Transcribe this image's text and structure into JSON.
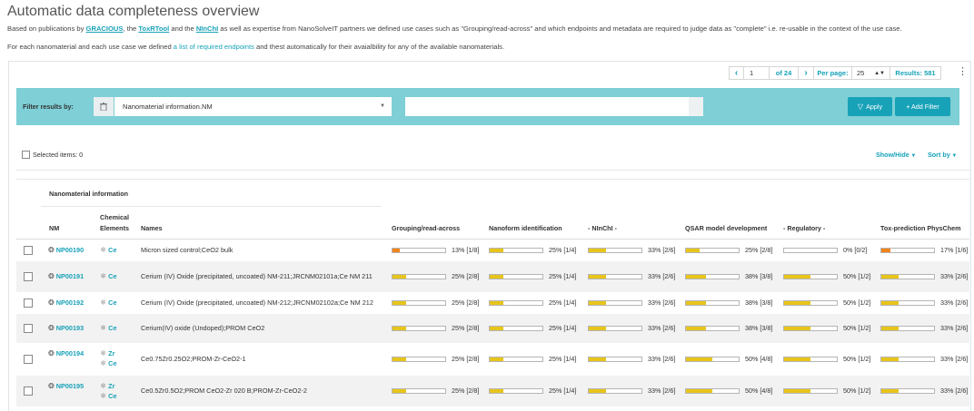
{
  "page": {
    "title": "Automatic data completeness overview",
    "intro1": {
      "pre": "Based on publications by ",
      "link1": "GRACIOUS",
      "mid1": ", the ",
      "link2": "ToxRTool",
      "mid2": " and the ",
      "link3": "NInChI",
      "post": " as well as expertise from NanoSolveIT partners we defined use cases such as \"Grouping/read-across\" and which endpoints and metadata are required to judge data as \"complete\" i.e. re-usable in the context of the use case."
    },
    "intro2": {
      "pre": "For each nanomaterial and each use case we defined ",
      "link": "a list of required endpoints",
      "post": " and thest automatically for their avaialbility for any of the available nanomaterials."
    }
  },
  "pager": {
    "prev": "‹",
    "page": "1",
    "of": "of 24",
    "next": "›",
    "per_page_label": "Per page:",
    "per_page_value": "25",
    "results": "Results: 581",
    "more": "⋮"
  },
  "filter": {
    "label": "Filter results by:",
    "selected": "Nanomaterial information.NM",
    "value": "",
    "apply": "Apply",
    "add": "+ Add Filter"
  },
  "toolbar": {
    "selected_items": "Selected items: 0",
    "show_hide": "Show/Hide",
    "sort_by": "Sort by"
  },
  "table": {
    "group_header": "Nanomaterial information",
    "headers": {
      "nm": "NM",
      "chem1": "Chemical",
      "chem2": "Elements",
      "names": "Names",
      "c1": "Grouping/read-across",
      "c2": "Nanoform identification",
      "c3": "- NInChI -",
      "c4": "QSAR model development",
      "c5": "- Regulatory -",
      "c6": "Tox-prediction PhysChem"
    },
    "colors": {
      "low": "#f0841b",
      "mid": "#e8c51a"
    },
    "rows": [
      {
        "nm": "NP00190",
        "elements": [
          "Ce"
        ],
        "name": "Micron sized control;CeO2 bulk",
        "scores": [
          {
            "pct": "13% [1/8]",
            "frac": 0.13,
            "c": "low"
          },
          {
            "pct": "25% [1/4]",
            "frac": 0.25,
            "c": "mid"
          },
          {
            "pct": "33% [2/6]",
            "frac": 0.33,
            "c": "mid"
          },
          {
            "pct": "25% [2/8]",
            "frac": 0.25,
            "c": "mid"
          },
          {
            "pct": "0% [0/2]",
            "frac": 0,
            "c": "low"
          },
          {
            "pct": "17% [1/6]",
            "frac": 0.17,
            "c": "low"
          }
        ]
      },
      {
        "nm": "NP00191",
        "elements": [
          "Ce"
        ],
        "name": "Cerium (IV) Oxide (precipitated, uncoated) NM-211;JRCNM02101a;Ce NM 211",
        "scores": [
          {
            "pct": "25% [2/8]",
            "frac": 0.25,
            "c": "mid"
          },
          {
            "pct": "25% [1/4]",
            "frac": 0.25,
            "c": "mid"
          },
          {
            "pct": "33% [2/6]",
            "frac": 0.33,
            "c": "mid"
          },
          {
            "pct": "38% [3/8]",
            "frac": 0.38,
            "c": "mid"
          },
          {
            "pct": "50% [1/2]",
            "frac": 0.5,
            "c": "mid"
          },
          {
            "pct": "33% [2/6]",
            "frac": 0.33,
            "c": "mid"
          }
        ]
      },
      {
        "nm": "NP00192",
        "elements": [
          "Ce"
        ],
        "name": "Cerium (IV) Oxide (precipitated, uncoated) NM-212;JRCNM02102a;Ce NM 212",
        "scores": [
          {
            "pct": "25% [2/8]",
            "frac": 0.25,
            "c": "mid"
          },
          {
            "pct": "25% [1/4]",
            "frac": 0.25,
            "c": "mid"
          },
          {
            "pct": "33% [2/6]",
            "frac": 0.33,
            "c": "mid"
          },
          {
            "pct": "38% [3/8]",
            "frac": 0.38,
            "c": "mid"
          },
          {
            "pct": "50% [1/2]",
            "frac": 0.5,
            "c": "mid"
          },
          {
            "pct": "33% [2/6]",
            "frac": 0.33,
            "c": "mid"
          }
        ]
      },
      {
        "nm": "NP00193",
        "elements": [
          "Ce"
        ],
        "name": "Cerium(IV) oxide (Undoped);PROM CeO2",
        "scores": [
          {
            "pct": "25% [2/8]",
            "frac": 0.25,
            "c": "mid"
          },
          {
            "pct": "25% [1/4]",
            "frac": 0.25,
            "c": "mid"
          },
          {
            "pct": "33% [2/6]",
            "frac": 0.33,
            "c": "mid"
          },
          {
            "pct": "38% [3/8]",
            "frac": 0.38,
            "c": "mid"
          },
          {
            "pct": "50% [1/2]",
            "frac": 0.5,
            "c": "mid"
          },
          {
            "pct": "33% [2/6]",
            "frac": 0.33,
            "c": "mid"
          }
        ]
      },
      {
        "nm": "NP00194",
        "elements": [
          "Zr",
          "Ce"
        ],
        "name": "Ce0.75Zr0.25O2;PROM-Zr-CeO2-1",
        "scores": [
          {
            "pct": "25% [2/8]",
            "frac": 0.25,
            "c": "mid"
          },
          {
            "pct": "25% [1/4]",
            "frac": 0.25,
            "c": "mid"
          },
          {
            "pct": "33% [2/6]",
            "frac": 0.33,
            "c": "mid"
          },
          {
            "pct": "50% [4/8]",
            "frac": 0.5,
            "c": "mid"
          },
          {
            "pct": "50% [1/2]",
            "frac": 0.5,
            "c": "mid"
          },
          {
            "pct": "33% [2/6]",
            "frac": 0.33,
            "c": "mid"
          }
        ]
      },
      {
        "nm": "NP00195",
        "elements": [
          "Zr",
          "Ce"
        ],
        "name": "Ce0.5Zr0.5O2;PROM CeO2-Zr 020 B;PROM-Zr-CeO2-2",
        "scores": [
          {
            "pct": "25% [2/8]",
            "frac": 0.25,
            "c": "mid"
          },
          {
            "pct": "25% [1/4]",
            "frac": 0.25,
            "c": "mid"
          },
          {
            "pct": "33% [2/6]",
            "frac": 0.33,
            "c": "mid"
          },
          {
            "pct": "50% [4/8]",
            "frac": 0.5,
            "c": "mid"
          },
          {
            "pct": "50% [1/2]",
            "frac": 0.5,
            "c": "mid"
          },
          {
            "pct": "33% [2/6]",
            "frac": 0.33,
            "c": "mid"
          }
        ]
      }
    ]
  }
}
